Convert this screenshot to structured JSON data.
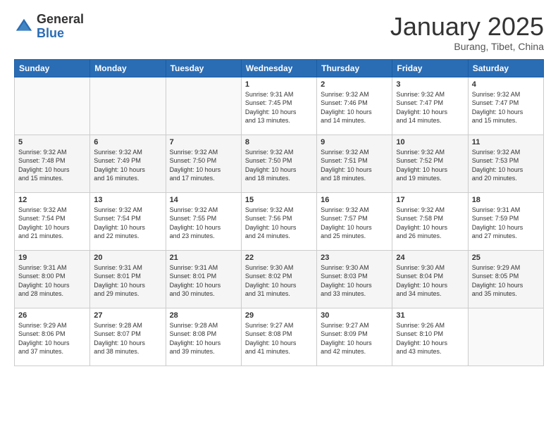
{
  "header": {
    "logo_general": "General",
    "logo_blue": "Blue",
    "title": "January 2025",
    "location": "Burang, Tibet, China"
  },
  "weekdays": [
    "Sunday",
    "Monday",
    "Tuesday",
    "Wednesday",
    "Thursday",
    "Friday",
    "Saturday"
  ],
  "weeks": [
    [
      {
        "day": "",
        "info": ""
      },
      {
        "day": "",
        "info": ""
      },
      {
        "day": "",
        "info": ""
      },
      {
        "day": "1",
        "info": "Sunrise: 9:31 AM\nSunset: 7:45 PM\nDaylight: 10 hours\nand 13 minutes."
      },
      {
        "day": "2",
        "info": "Sunrise: 9:32 AM\nSunset: 7:46 PM\nDaylight: 10 hours\nand 14 minutes."
      },
      {
        "day": "3",
        "info": "Sunrise: 9:32 AM\nSunset: 7:47 PM\nDaylight: 10 hours\nand 14 minutes."
      },
      {
        "day": "4",
        "info": "Sunrise: 9:32 AM\nSunset: 7:47 PM\nDaylight: 10 hours\nand 15 minutes."
      }
    ],
    [
      {
        "day": "5",
        "info": "Sunrise: 9:32 AM\nSunset: 7:48 PM\nDaylight: 10 hours\nand 15 minutes."
      },
      {
        "day": "6",
        "info": "Sunrise: 9:32 AM\nSunset: 7:49 PM\nDaylight: 10 hours\nand 16 minutes."
      },
      {
        "day": "7",
        "info": "Sunrise: 9:32 AM\nSunset: 7:50 PM\nDaylight: 10 hours\nand 17 minutes."
      },
      {
        "day": "8",
        "info": "Sunrise: 9:32 AM\nSunset: 7:50 PM\nDaylight: 10 hours\nand 18 minutes."
      },
      {
        "day": "9",
        "info": "Sunrise: 9:32 AM\nSunset: 7:51 PM\nDaylight: 10 hours\nand 18 minutes."
      },
      {
        "day": "10",
        "info": "Sunrise: 9:32 AM\nSunset: 7:52 PM\nDaylight: 10 hours\nand 19 minutes."
      },
      {
        "day": "11",
        "info": "Sunrise: 9:32 AM\nSunset: 7:53 PM\nDaylight: 10 hours\nand 20 minutes."
      }
    ],
    [
      {
        "day": "12",
        "info": "Sunrise: 9:32 AM\nSunset: 7:54 PM\nDaylight: 10 hours\nand 21 minutes."
      },
      {
        "day": "13",
        "info": "Sunrise: 9:32 AM\nSunset: 7:54 PM\nDaylight: 10 hours\nand 22 minutes."
      },
      {
        "day": "14",
        "info": "Sunrise: 9:32 AM\nSunset: 7:55 PM\nDaylight: 10 hours\nand 23 minutes."
      },
      {
        "day": "15",
        "info": "Sunrise: 9:32 AM\nSunset: 7:56 PM\nDaylight: 10 hours\nand 24 minutes."
      },
      {
        "day": "16",
        "info": "Sunrise: 9:32 AM\nSunset: 7:57 PM\nDaylight: 10 hours\nand 25 minutes."
      },
      {
        "day": "17",
        "info": "Sunrise: 9:32 AM\nSunset: 7:58 PM\nDaylight: 10 hours\nand 26 minutes."
      },
      {
        "day": "18",
        "info": "Sunrise: 9:31 AM\nSunset: 7:59 PM\nDaylight: 10 hours\nand 27 minutes."
      }
    ],
    [
      {
        "day": "19",
        "info": "Sunrise: 9:31 AM\nSunset: 8:00 PM\nDaylight: 10 hours\nand 28 minutes."
      },
      {
        "day": "20",
        "info": "Sunrise: 9:31 AM\nSunset: 8:01 PM\nDaylight: 10 hours\nand 29 minutes."
      },
      {
        "day": "21",
        "info": "Sunrise: 9:31 AM\nSunset: 8:01 PM\nDaylight: 10 hours\nand 30 minutes."
      },
      {
        "day": "22",
        "info": "Sunrise: 9:30 AM\nSunset: 8:02 PM\nDaylight: 10 hours\nand 31 minutes."
      },
      {
        "day": "23",
        "info": "Sunrise: 9:30 AM\nSunset: 8:03 PM\nDaylight: 10 hours\nand 33 minutes."
      },
      {
        "day": "24",
        "info": "Sunrise: 9:30 AM\nSunset: 8:04 PM\nDaylight: 10 hours\nand 34 minutes."
      },
      {
        "day": "25",
        "info": "Sunrise: 9:29 AM\nSunset: 8:05 PM\nDaylight: 10 hours\nand 35 minutes."
      }
    ],
    [
      {
        "day": "26",
        "info": "Sunrise: 9:29 AM\nSunset: 8:06 PM\nDaylight: 10 hours\nand 37 minutes."
      },
      {
        "day": "27",
        "info": "Sunrise: 9:28 AM\nSunset: 8:07 PM\nDaylight: 10 hours\nand 38 minutes."
      },
      {
        "day": "28",
        "info": "Sunrise: 9:28 AM\nSunset: 8:08 PM\nDaylight: 10 hours\nand 39 minutes."
      },
      {
        "day": "29",
        "info": "Sunrise: 9:27 AM\nSunset: 8:08 PM\nDaylight: 10 hours\nand 41 minutes."
      },
      {
        "day": "30",
        "info": "Sunrise: 9:27 AM\nSunset: 8:09 PM\nDaylight: 10 hours\nand 42 minutes."
      },
      {
        "day": "31",
        "info": "Sunrise: 9:26 AM\nSunset: 8:10 PM\nDaylight: 10 hours\nand 43 minutes."
      },
      {
        "day": "",
        "info": ""
      }
    ]
  ]
}
